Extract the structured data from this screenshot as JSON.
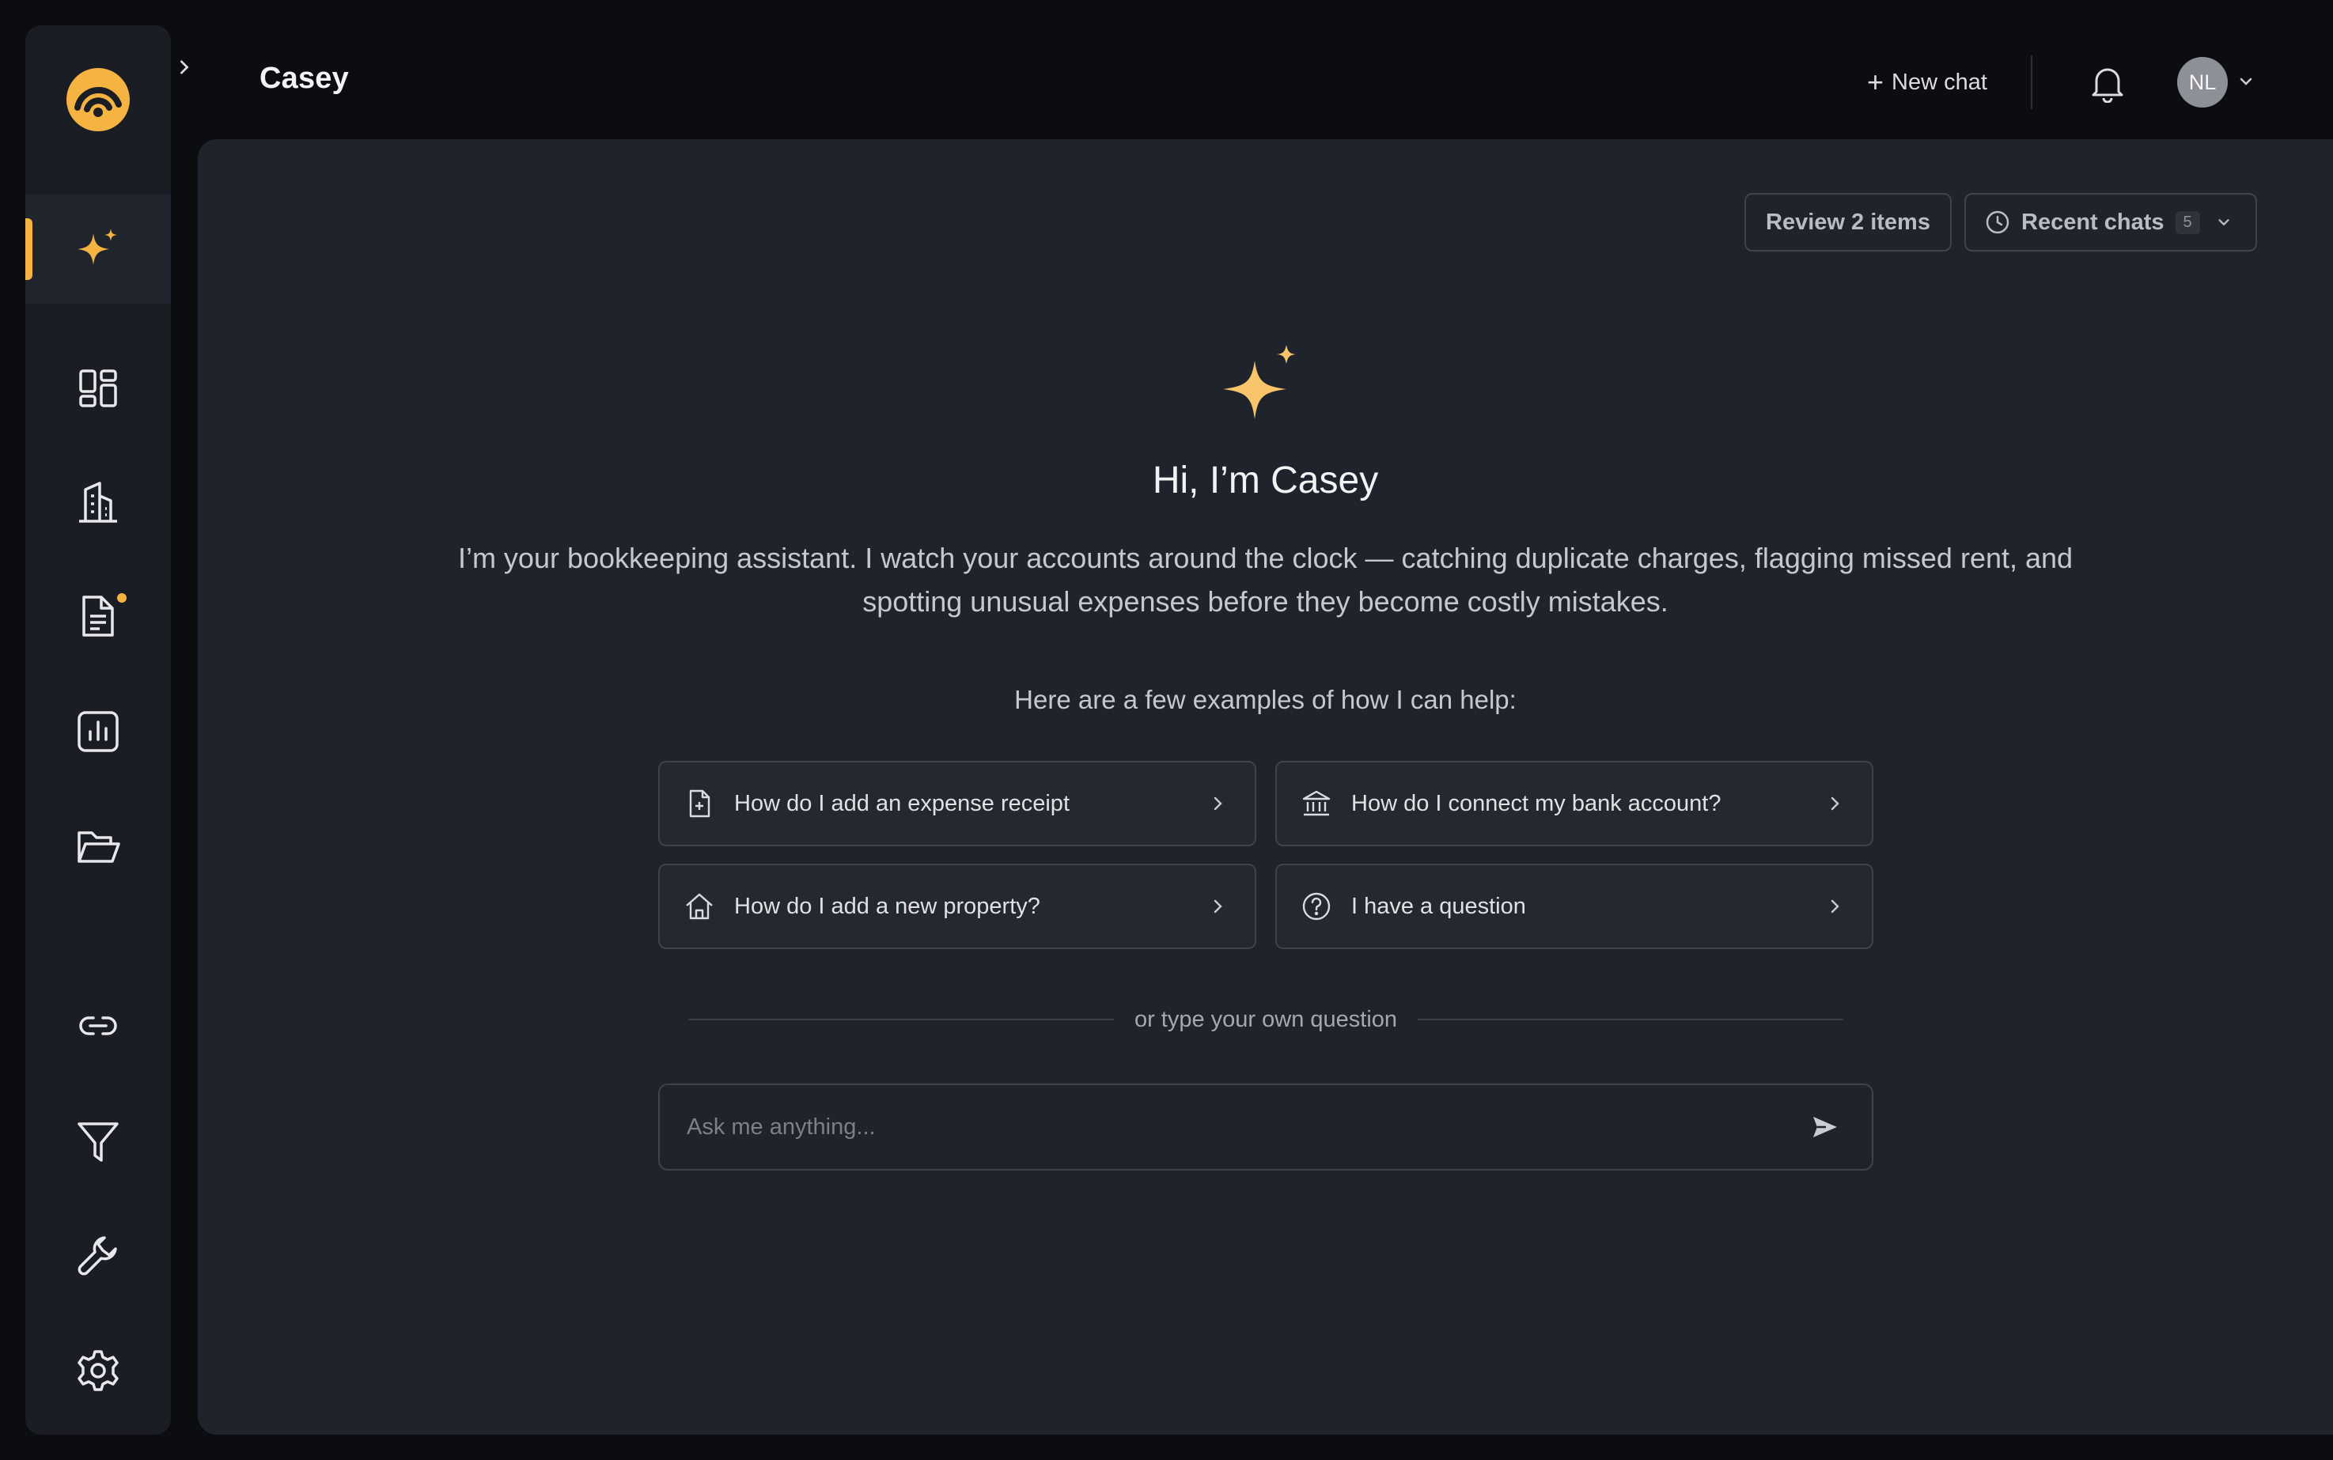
{
  "header": {
    "title": "Casey",
    "new_chat_label": "New chat",
    "avatar_initials": "NL"
  },
  "sidebar": {
    "items": [
      {
        "name": "assistant",
        "icon": "sparkle-icon",
        "active": true
      },
      {
        "name": "dashboard",
        "icon": "dashboard-icon"
      },
      {
        "name": "properties",
        "icon": "building-icon"
      },
      {
        "name": "documents",
        "icon": "document-icon",
        "notification": true
      },
      {
        "name": "reports",
        "icon": "chart-icon"
      },
      {
        "name": "files",
        "icon": "folder-icon"
      },
      {
        "name": "connections",
        "icon": "link-icon"
      },
      {
        "name": "filters",
        "icon": "filter-icon"
      },
      {
        "name": "tools",
        "icon": "wrench-icon"
      },
      {
        "name": "settings",
        "icon": "gear-icon"
      }
    ]
  },
  "toolbar": {
    "review_label": "Review 2 items",
    "recent_label": "Recent chats",
    "recent_count": "5"
  },
  "hero": {
    "greeting": "Hi, I’m Casey",
    "intro": "I’m your bookkeeping assistant. I watch your accounts around the clock — catching duplicate charges, flagging missed rent, and spotting unusual expenses before they become costly mistakes.",
    "examples_label": "Here are a few examples of how I can help:"
  },
  "examples": [
    {
      "label": "How do I add an expense receipt",
      "icon": "receipt-icon"
    },
    {
      "label": "How do I connect my bank account?",
      "icon": "bank-icon"
    },
    {
      "label": "How do I add a new property?",
      "icon": "home-icon"
    },
    {
      "label": "I have a question",
      "icon": "question-icon"
    }
  ],
  "divider_text": "or type your own question",
  "input": {
    "placeholder": "Ask me anything...",
    "value": ""
  },
  "colors": {
    "accent": "#f5b342",
    "background": "#0b0d11",
    "panel": "#1f232b",
    "sidebar": "#1a1d24"
  }
}
